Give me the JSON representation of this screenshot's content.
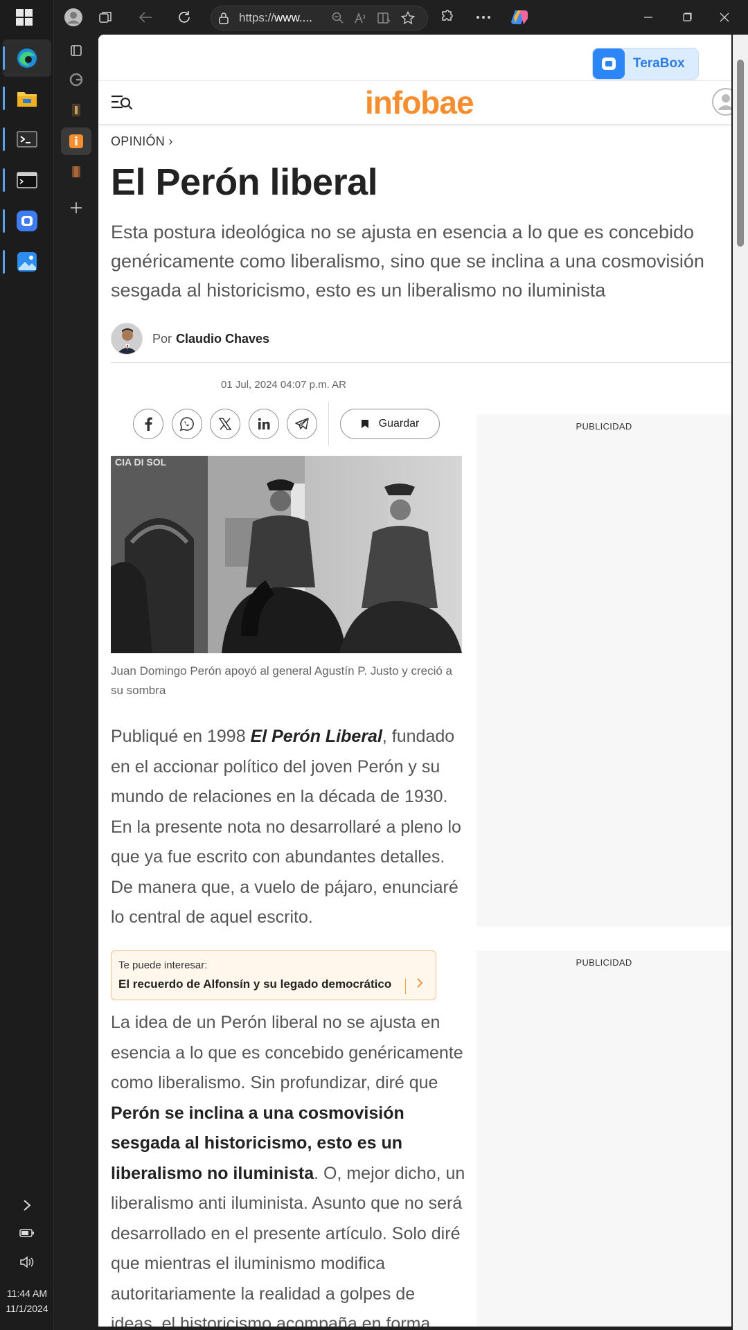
{
  "taskbar": {
    "time": "11:44 AM",
    "date": "11/1/2024"
  },
  "browser": {
    "url_prefix": "https://",
    "url_host": "www...."
  },
  "ad_top": {
    "brand": "TeraBox"
  },
  "site": {
    "logo": "infobae"
  },
  "article": {
    "section": "OPINIÓN ›",
    "headline": "El Perón liberal",
    "deck": "Esta postura ideológica no se ajusta en esencia a lo que es concebido genéricamente como liberalismo, sino que se inclina a una cosmovisión sesgada al historicismo, esto es un liberalismo no iluminista",
    "by_prefix": "Por",
    "author": "Claudio Chaves",
    "date": "01 Jul, 2024 04:07 p.m. AR",
    "save_label": "Guardar",
    "photo_caption": "Juan Domingo Perón apoyó al general Agustín P. Justo y creció a su sombra",
    "p1_start": "Publiqué en 1998 ",
    "p1_title": "El Perón Liberal",
    "p1_rest": ", fundado en el accionar político del joven Perón y su mundo de relaciones en la década de 1930. En la presente nota no desarrollaré a pleno lo que ya fue escrito con abundantes detalles. De manera que, a vuelo de pájaro, enunciaré lo central de aquel escrito.",
    "related_label": "Te puede interesar:",
    "related_title": "El recuerdo de Alfonsín y su legado democrático",
    "p2_start": "La idea de un Perón liberal no se ajusta en esencia a lo que es concebido genéricamente como liberalismo. Sin profundizar, diré que ",
    "p2_bold": "Perón se inclina a una cosmovisión sesgada al historicismo, esto es un liberalismo no iluminista",
    "p2_rest": ". O, mejor dicho, un liberalismo anti iluminista. Asunto que no será desarrollado en el presente artículo. Solo diré que mientras el iluminismo modifica autoritariamente la realidad a golpes de ideas, el historicismo acompaña en forma"
  },
  "ads": {
    "label1": "PUBLICIDAD",
    "label2": "PUBLICIDAD"
  }
}
